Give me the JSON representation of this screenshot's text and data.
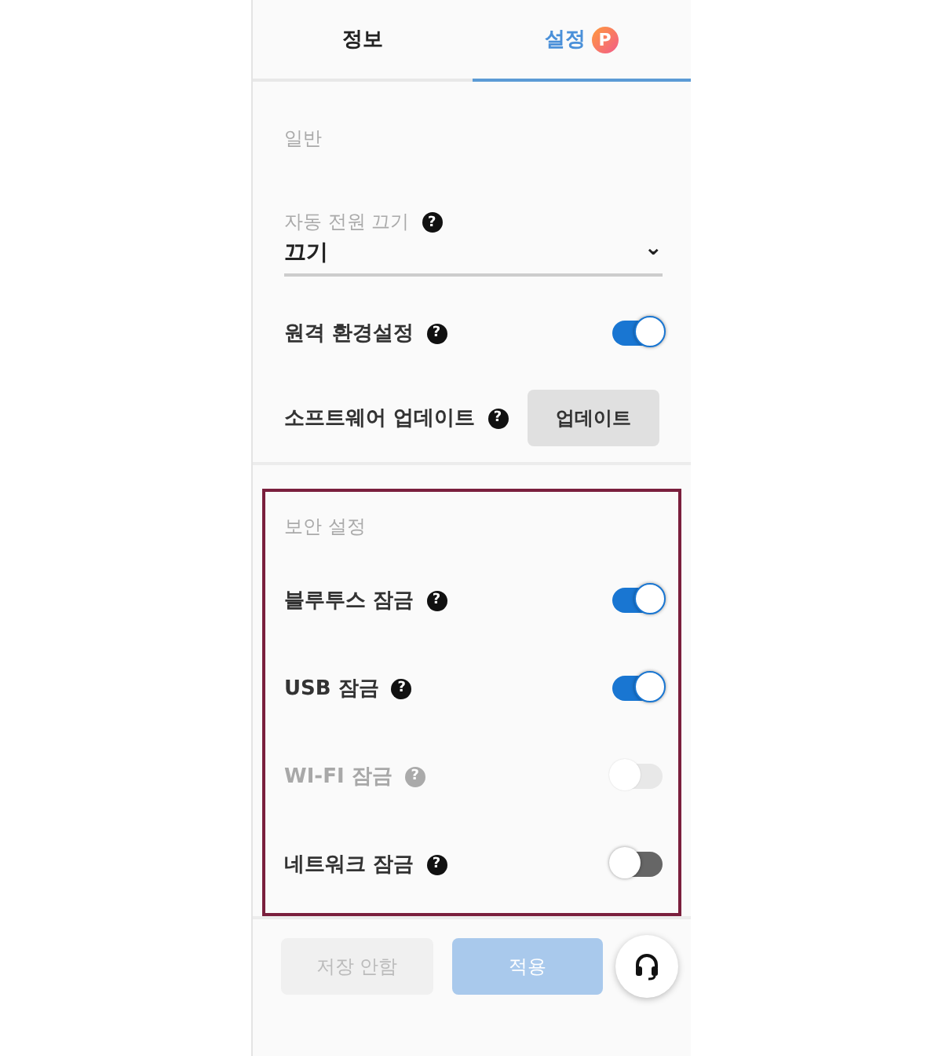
{
  "tabs": [
    {
      "label": "정보",
      "selected": false
    },
    {
      "label": "설정",
      "selected": true,
      "badge": "P"
    }
  ],
  "general": {
    "heading": "일반",
    "dropdown": {
      "label": "자동 전원 끄기",
      "value": "끄기",
      "help": "?",
      "caret": "⌄"
    },
    "rows": [
      {
        "kind": "toggle",
        "label": "원격 환경설정",
        "help": "?",
        "on": true,
        "disabled": false
      },
      {
        "kind": "button",
        "label": "소프트웨어 업데이트",
        "help": "?",
        "button": "업데이트"
      }
    ]
  },
  "security": {
    "heading": "보안 설정",
    "rows": [
      {
        "kind": "toggle",
        "label": "블루투스 잠금",
        "help": "?",
        "on": true,
        "disabled": false
      },
      {
        "kind": "toggle",
        "label": "USB 잠금",
        "help": "?",
        "on": true,
        "disabled": false
      },
      {
        "kind": "toggle",
        "label": "WI-FI 잠금",
        "help": "?",
        "on": false,
        "disabled": true
      },
      {
        "kind": "toggle",
        "label": "네트워크 잠금",
        "help": "?",
        "on": false,
        "disabled": false
      }
    ]
  },
  "footer": [
    {
      "kind": "secondary",
      "label": "저장 안함",
      "disabled": true
    },
    {
      "kind": "primary",
      "label": "적용",
      "disabled": true
    }
  ]
}
